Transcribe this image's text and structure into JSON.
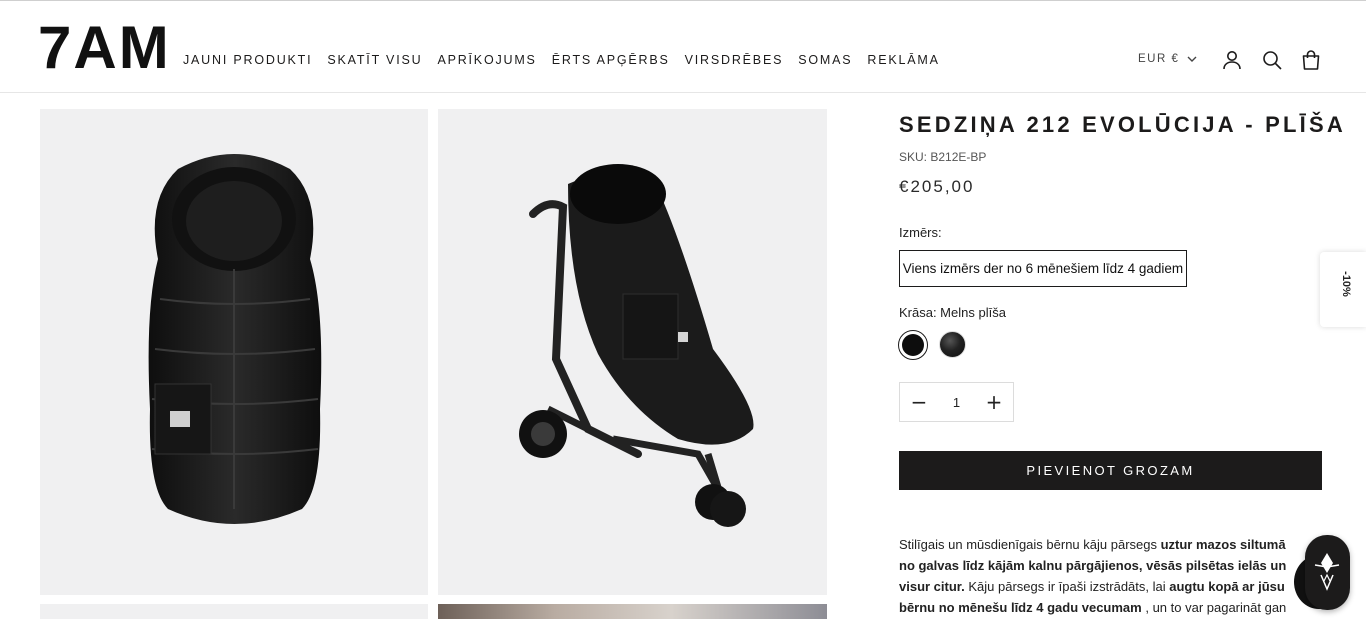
{
  "header": {
    "logo": "7AM",
    "nav": [
      "JAUNI PRODUKTI",
      "SKATĪT VISU",
      "APRĪKOJUMS",
      "ĒRTS APĢĒRBS",
      "VIRSDRĒBES",
      "SOMAS",
      "REKLĀMA"
    ],
    "currency": "EUR €",
    "icons": [
      "account-icon",
      "search-icon",
      "cart-icon"
    ]
  },
  "product": {
    "title": "SEDZIŅA 212 EVOLŪCIJA - PLĪŠA",
    "sku": "SKU: B212E-BP",
    "price": "€205,00",
    "size_label": "Izmērs:",
    "size_option": "Viens izmērs der no 6 mēnešiem līdz 4 gadiem",
    "color_label": "Krāsa: Melns plīša",
    "colors": [
      "#0d0d0d",
      "#2a2a2a"
    ],
    "quantity": "1",
    "add_to_cart": "PIEVIENOT GROZAM",
    "description": {
      "p1": "Stilīgais un mūsdienīgais bērnu kāju pārsegs ",
      "b1": "uztur mazos siltumā no galvas līdz kājām kalnu pārgājienos, vēsās pilsētas ielās un visur citur.",
      "p2": " Kāju pārsegs ir īpaši izstrādāts, lai ",
      "b2": "augtu kopā ar jūsu bērnu no mēnešu līdz 4 gadu vecumam",
      "p3": " , un to var pagarināt gan garumā, gan"
    }
  },
  "side": {
    "discount": "-10%"
  },
  "colors": {
    "accent": "#1c1b1b",
    "background": "#ffffff",
    "image_bg": "#f0f0f1"
  }
}
